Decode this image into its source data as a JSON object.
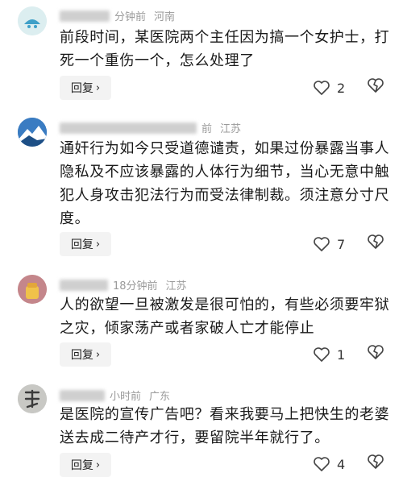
{
  "comments": [
    {
      "time": "分钟前",
      "region": "河南",
      "text": "前段时间，某医院两个主任因为搞一个女护士，打死一个重伤一个，怎么处理了",
      "reply_label": "回复",
      "likes": "2"
    },
    {
      "time": "前",
      "region": "江苏",
      "text": "通奸行为如今只受道德谴责，如果过份暴露当事人隐私及不应该暴露的人体行为细节，当心无意中触犯人身攻击犯法行为而受法律制裁。须注意分寸尺度。",
      "reply_label": "回复",
      "likes": "7"
    },
    {
      "time": "18分钟前",
      "region": "江苏",
      "text": "人的欲望一旦被激发是很可怕的，有些必须要牢狱之灾，倾家荡产或者家破人亡才能停止",
      "reply_label": "回复",
      "likes": "1"
    },
    {
      "time": "小时前",
      "region": "广东",
      "text": "是医院的宣传广告吧？看来我要马上把快生的老婆送去成二待产才行，要留院半年就行了。",
      "reply_label": "回复",
      "likes": "4"
    }
  ]
}
